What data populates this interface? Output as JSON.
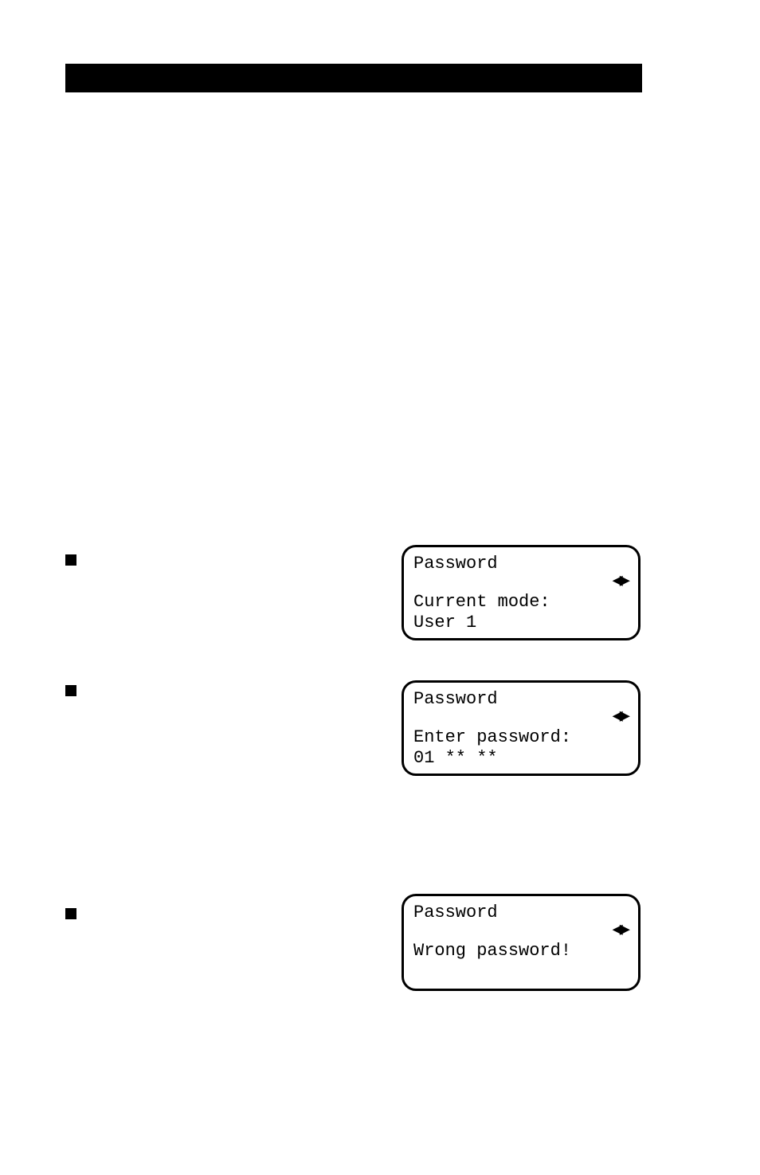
{
  "header": {
    "bar": ""
  },
  "lcd1": {
    "title": "Password",
    "arrow": "◀▶",
    "line1": "Current mode:",
    "line2": "User 1"
  },
  "lcd2": {
    "title": "Password",
    "arrow": "◀▶",
    "line1": "Enter password:",
    "line2": "01 ** **"
  },
  "lcd3": {
    "title": "Password",
    "arrow": "◀▶",
    "line1": "Wrong password!",
    "line2": ""
  }
}
